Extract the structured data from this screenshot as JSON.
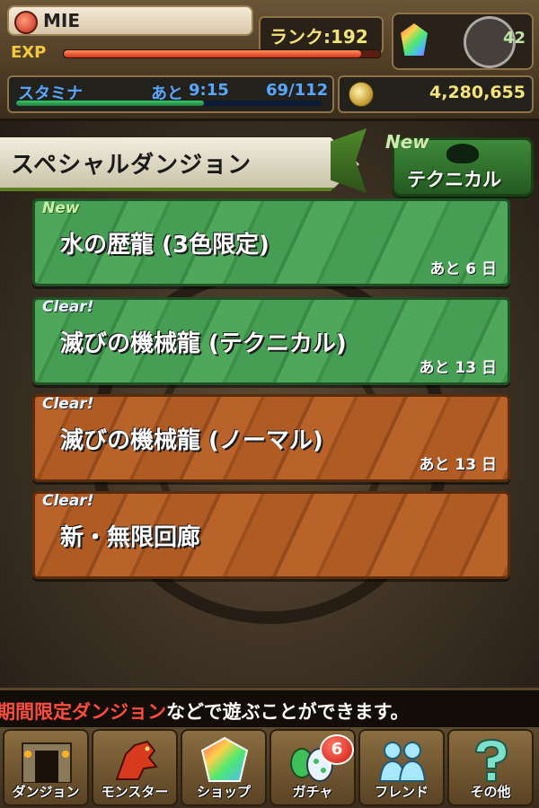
{
  "header": {
    "player_name": "MIE",
    "rank": "ランク:192",
    "exp_label": "EXP",
    "exp_progress": 0.94,
    "magic_stones": "42",
    "stamina_label": "スタミナ",
    "stamina_time_label": "あと",
    "stamina_time": "9:15",
    "stamina_value": "69/112",
    "stamina_progress": 0.616,
    "coins": "4,280,655"
  },
  "section": {
    "title": "スペシャルダンジョン",
    "technical_button": {
      "badge": "New",
      "label": "テクニカル"
    }
  },
  "dungeons": [
    {
      "badge": "New",
      "title": "水の歴龍 (3色限定)",
      "remaining": "あと 6 日",
      "color": "green"
    },
    {
      "badge": "Clear!",
      "title": "滅びの機械龍 (テクニカル)",
      "remaining": "あと 13 日",
      "color": "green"
    },
    {
      "badge": "Clear!",
      "title": "滅びの機械龍 (ノーマル)",
      "remaining": "あと 13 日",
      "color": "brown"
    },
    {
      "badge": "Clear!",
      "title": "新・無限回廊",
      "remaining": "",
      "color": "brown"
    }
  ],
  "ticker": {
    "red_part": "期間限定ダンジョン",
    "rest": "などで遊ぶことができます。"
  },
  "nav": {
    "items": [
      {
        "label": "ダンジョン",
        "icon": "dungeon-gate-icon"
      },
      {
        "label": "モンスター",
        "icon": "dragon-icon"
      },
      {
        "label": "ショップ",
        "icon": "gem-icon"
      },
      {
        "label": "ガチャ",
        "icon": "egg-icon",
        "badge": "6"
      },
      {
        "label": "フレンド",
        "icon": "friends-icon"
      },
      {
        "label": "その他",
        "icon": "question-icon"
      }
    ]
  },
  "colors": {
    "green_panel": "#4ea75b",
    "brown_panel": "#b9632a",
    "rank_text": "#f4e27a",
    "stamina_text": "#5aa6ff",
    "ticker_red": "#ff4d3d"
  }
}
